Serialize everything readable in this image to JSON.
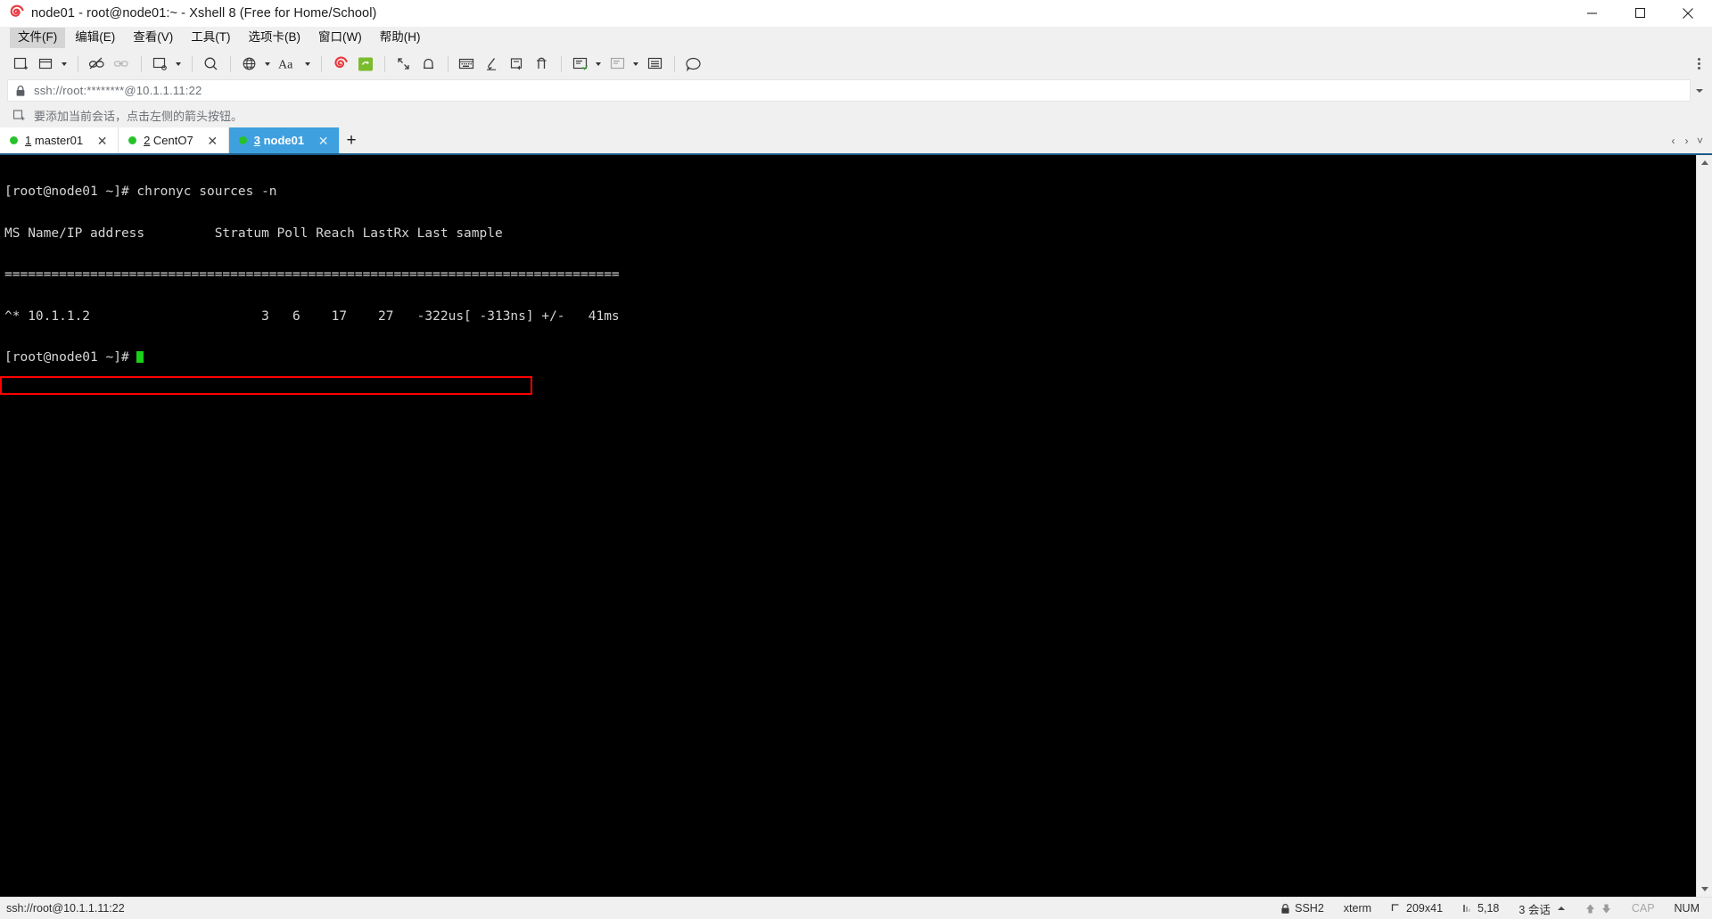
{
  "window": {
    "title": "node01 - root@node01:~ - Xshell 8 (Free for Home/School)",
    "logo_icon": "xshell-spiral-logo",
    "minimize_label": "—",
    "maximize_label": "□",
    "close_label": "✕"
  },
  "menubar": {
    "items": [
      {
        "label": "文件(F)",
        "name": "menu-file",
        "active": true
      },
      {
        "label": "编辑(E)",
        "name": "menu-edit",
        "active": false
      },
      {
        "label": "查看(V)",
        "name": "menu-view",
        "active": false
      },
      {
        "label": "工具(T)",
        "name": "menu-tools",
        "active": false
      },
      {
        "label": "选项卡(B)",
        "name": "menu-tabs",
        "active": false
      },
      {
        "label": "窗口(W)",
        "name": "menu-window",
        "active": false
      },
      {
        "label": "帮助(H)",
        "name": "menu-help",
        "active": false
      }
    ]
  },
  "toolbar": {
    "icons": [
      "new-session-icon",
      "open-folder-icon",
      "dropdown-caret",
      "disconnect-icon",
      "link-icon",
      "new-file-transfer-icon",
      "dropdown-caret",
      "find-icon",
      "globe-icon",
      "dropdown-caret",
      "font-size-icon",
      "dropdown-caret",
      "xshell-spiral-icon",
      "xftp-icon",
      "fullscreen-icon",
      "lock-icon",
      "keyboard-icon",
      "highlight-icon",
      "send-key-icon",
      "compose-icon",
      "split-vertical-icon",
      "split-horizontal-icon",
      "layout-icon",
      "chat-icon"
    ],
    "overflow_label": "更多"
  },
  "address": {
    "lock_icon": "lock-icon",
    "value": "ssh://root:********@10.1.1.11:22",
    "placeholder": "ssh://",
    "dropdown_icon": "chevron-down-icon"
  },
  "notice": {
    "icon": "add-session-icon",
    "text": "要添加当前会话，点击左侧的箭头按钮。"
  },
  "tabs": {
    "items": [
      {
        "num": "1",
        "label": "master01",
        "active": false,
        "status": "connected"
      },
      {
        "num": "2",
        "label": "CentO7",
        "active": false,
        "status": "connected"
      },
      {
        "num": "3",
        "label": "node01",
        "active": true,
        "status": "connected"
      }
    ],
    "add_label": "+",
    "nav_prev": "‹",
    "nav_next": "›",
    "nav_list": "˅"
  },
  "terminal": {
    "lines": [
      "[root@node01 ~]# chronyc sources -n",
      "MS Name/IP address         Stratum Poll Reach LastRx Last sample",
      "===============================================================================",
      "^* 10.1.1.2                      3   6    17    27   -322us[ -313ns] +/-   41ms",
      "[root@node01 ~]# "
    ],
    "highlight": {
      "line_index": 3,
      "color": "#ff0000",
      "label": "red-highlight-box"
    },
    "cursor": {
      "visible": true,
      "color": "#19d219"
    },
    "bg": "#000000",
    "fg": "#d6d6d6"
  },
  "statusbar": {
    "connection": "ssh://root@10.1.1.11:22",
    "security": "SSH2",
    "security_icon": "lock-icon",
    "terminal_type": "xterm",
    "size_icon": "screen-size-icon",
    "size": "209x41",
    "cursor_icon": "cursor-pos-icon",
    "cursor_pos": "5,18",
    "sessions": "3 会话",
    "sessions_caret": "caret-up-icon",
    "upload_icon": "arrow-up-icon",
    "download_icon": "arrow-down-icon",
    "cap": "CAP",
    "num": "NUM"
  }
}
